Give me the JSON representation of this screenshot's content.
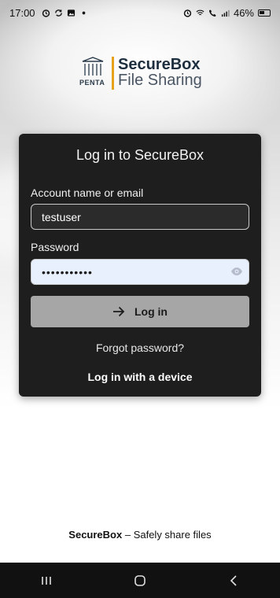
{
  "status_bar": {
    "time": "17:00",
    "battery": "46%",
    "left_icons": [
      "alarm-icon",
      "sync-icon",
      "gallery-icon",
      "dot-icon"
    ],
    "right_icons": [
      "alarm-icon",
      "wifi-icon",
      "signal-r-icon",
      "call-icon",
      "signal-icon",
      "battery-icon"
    ]
  },
  "logo": {
    "mark_caption": "PENTA",
    "line1": "SecureBox",
    "line2": "File Sharing",
    "accent_color": "#e6a21a"
  },
  "login": {
    "title": "Log in to SecureBox",
    "username_label": "Account name or email",
    "username_value": "testuser",
    "password_label": "Password",
    "password_value": "•••••••••••",
    "login_button": "Log in",
    "forgot_password": "Forgot password?",
    "device_login": "Log in with a device"
  },
  "footer": {
    "brand": "SecureBox",
    "separator": " – ",
    "tagline": "Safely share files"
  },
  "nav_bar": {
    "buttons": [
      "recents-icon",
      "home-icon",
      "back-icon"
    ]
  }
}
